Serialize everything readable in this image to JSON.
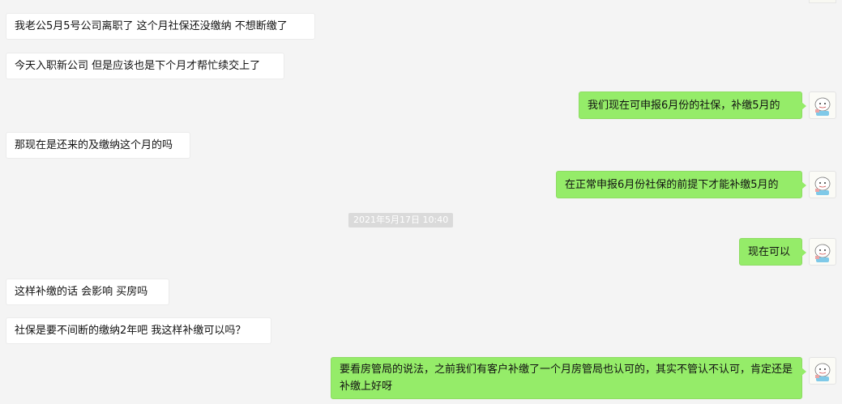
{
  "messages": [
    {
      "side": "in",
      "text": "我老公5月5号公司离职了  这个月社保还没缴纳 不想断缴了"
    },
    {
      "side": "in",
      "text": "今天入职新公司 但是应该也是下个月才帮忙续交上了"
    },
    {
      "side": "out",
      "text": "我们现在可申报6月份的社保，补缴5月的"
    },
    {
      "side": "in",
      "text": "那现在是还来的及缴纳这个月的吗"
    },
    {
      "side": "out",
      "text": "在正常申报6月份社保的前提下才能补缴5月的"
    },
    {
      "side": "time",
      "text": "2021年5月17日 10:40"
    },
    {
      "side": "out",
      "text": "现在可以"
    },
    {
      "side": "in",
      "text": "这样补缴的话   会影响 买房吗"
    },
    {
      "side": "in",
      "text": "社保是要不间断的缴纳2年吧  我这样补缴可以吗？"
    },
    {
      "side": "out",
      "text": "要看房管局的说法，之前我们有客户补缴了一个月房管局也认可的，其实不管认不认可，肯定还是补缴上好呀"
    }
  ],
  "colors": {
    "background": "#f4f4f4",
    "incoming_bubble": "#ffffff",
    "outgoing_bubble": "#95ec69",
    "timestamp_bg": "#dadada"
  },
  "icons": {
    "self_avatar": "cartoon-avatar-icon"
  }
}
